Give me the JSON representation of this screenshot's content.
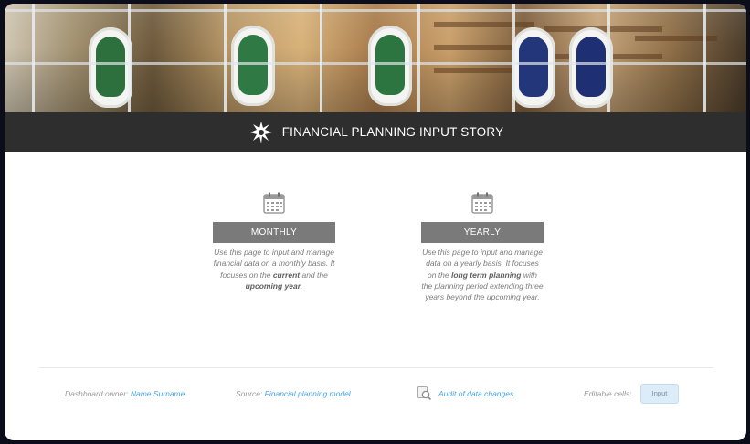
{
  "header": {
    "title": "FINANCIAL PLANNING INPUT STORY"
  },
  "cards": {
    "monthly": {
      "button_label": "MONTHLY",
      "desc_1": "Use this page to input and manage financial data on a monthly basis. It focuses on the ",
      "bold_1": "current",
      "desc_2": " and the ",
      "bold_2": "upcoming year",
      "desc_3": "."
    },
    "yearly": {
      "button_label": "YEARLY",
      "desc_1": "Use this page to input and manage data on a yearly basis. It focuses on the ",
      "bold_1": "long term planning",
      "desc_2": " with the planning period extending three years beyond the upcoming year."
    }
  },
  "footer": {
    "owner_label": "Dashboard owner: ",
    "owner_name": "Name Surname",
    "source_label": "Source: ",
    "source_name": "Financial planning model",
    "audit_link": "Audit of data changes",
    "editable_label": "Editable cells:",
    "input_chip": "Input"
  },
  "colors": {
    "title_bar": "#2e2e2e",
    "button_gray": "#7a7a7a",
    "link_blue": "#4aa3df",
    "input_chip": "#dcecf8"
  },
  "icons": {
    "header": "university-logo-icon",
    "monthly": "calendar-icon",
    "yearly": "calendar-icon",
    "audit": "magnifier-audit-icon"
  }
}
